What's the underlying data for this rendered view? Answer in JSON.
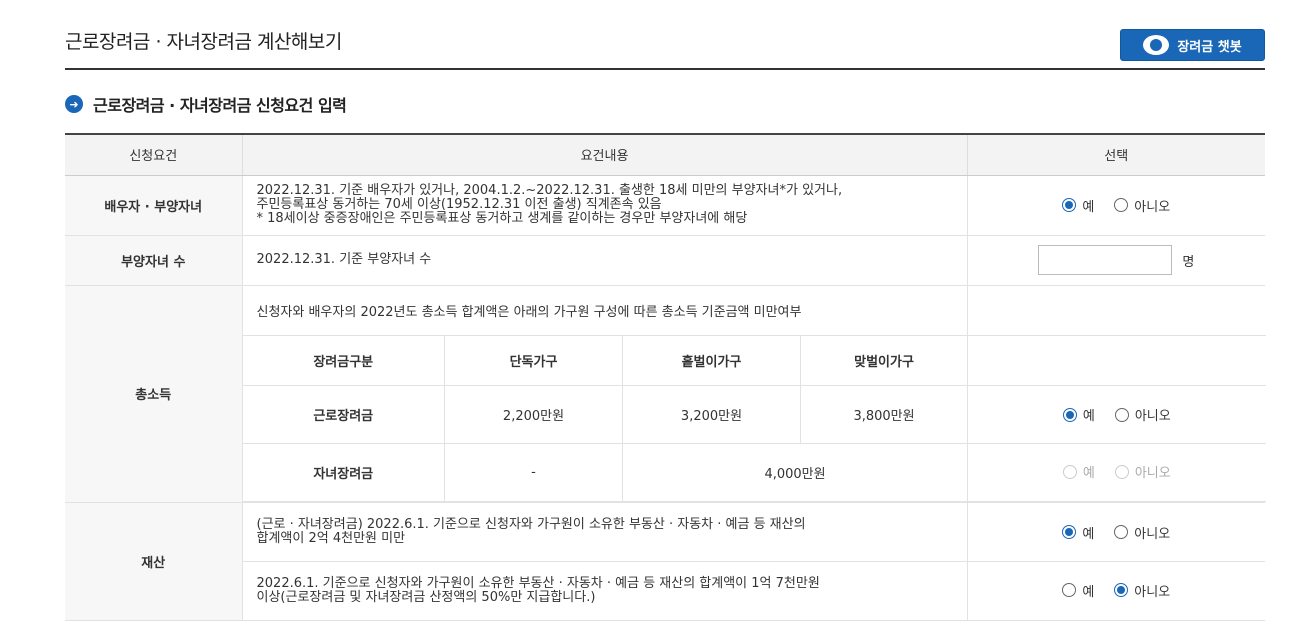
{
  "header": {
    "title": "근로장려금 · 자녀장려금 계산해보기",
    "chatbot_label": "장려금 챗봇"
  },
  "section": {
    "title": "근로장려금 · 자녀장려금 신청요건 입력"
  },
  "table": {
    "headers": [
      "신청요건",
      "요건내용",
      "선택"
    ],
    "spouse": {
      "label": "배우자 · 부양자녀",
      "line1": "2022.12.31. 기준 배우자가 있거나, 2004.1.2.~2022.12.31. 출생한 18세 미만의 부양자녀*가 있거나,",
      "line2": "주민등록표상 동거하는 70세 이상(1952.12.31 이전 출생) 직계존속 있음",
      "line3": "* 18세이상 중증장애인은 주민등록표상 동거하고 생계를 같이하는 경우만 부양자녀에 해당"
    },
    "children": {
      "label": "부양자녀 수",
      "content": "2022.12.31. 기준 부양자녀 수",
      "value": "",
      "unit": "명"
    },
    "income": {
      "label": "총소득",
      "intro": "신청자와 배우자의 2022년도 총소득 합계액은 아래의 가구원 구성에 따른 총소득 기준금액 미만여부",
      "sub_headers": [
        "장려금구분",
        "단독가구",
        "홑벌이가구",
        "맞벌이가구"
      ],
      "work_row": [
        "근로장려금",
        "2,200만원",
        "3,200만원",
        "3,800만원"
      ],
      "child_row": [
        "자녀장려금",
        "-",
        "4,000만원"
      ]
    },
    "property": {
      "label": "재산",
      "row1_line1": "(근로 · 자녀장려금) 2022.6.1. 기준으로 신청자와 가구원이 소유한 부동산 · 자동차 · 예금 등 재산의",
      "row1_line2": "합계액이 2억 4천만원 미만",
      "row2_line1": "2022.6.1. 기준으로 신청자와 가구원이 소유한 부동산 · 자동차 · 예금 등 재산의 합계액이 1억 7천만원",
      "row2_line2": "이상(근로장려금 및 자녀장려금 산정액의 50%만 지급합니다.)"
    },
    "options": {
      "yes": "예",
      "no": "아니오"
    }
  }
}
